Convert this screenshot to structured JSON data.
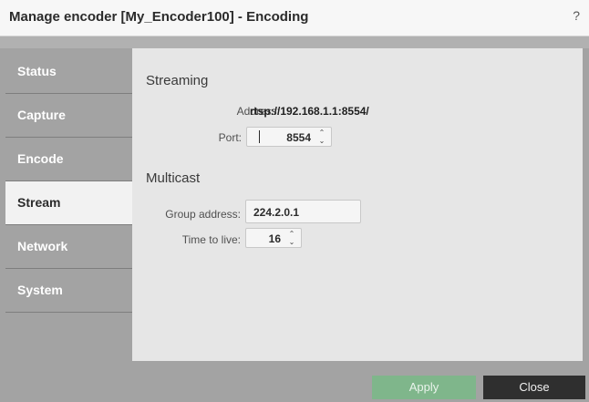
{
  "window": {
    "title": "Manage encoder [My_Encoder100] - Encoding",
    "help_label": "?"
  },
  "sidebar": {
    "items": [
      {
        "label": "Status"
      },
      {
        "label": "Capture"
      },
      {
        "label": "Encode"
      },
      {
        "label": "Stream",
        "active": true
      },
      {
        "label": "Network"
      },
      {
        "label": "System"
      }
    ]
  },
  "streaming": {
    "section_title": "Streaming",
    "address_label": "Address:",
    "address_value": "rtsp://192.168.1.1:8554/",
    "port_label": "Port:",
    "port_value": "8554"
  },
  "multicast": {
    "section_title": "Multicast",
    "group_label": "Group address:",
    "group_value": "224.2.0.1",
    "ttl_label": "Time to live:",
    "ttl_value": "16"
  },
  "footer": {
    "apply_label": "Apply",
    "close_label": "Close"
  },
  "icons": {
    "spin_up": "chevron-up-icon",
    "spin_down": "chevron-down-icon"
  },
  "colors": {
    "apply_button": "#7fb68b",
    "close_button": "#2f2f2f",
    "active_tab": "#f2f2f2"
  }
}
